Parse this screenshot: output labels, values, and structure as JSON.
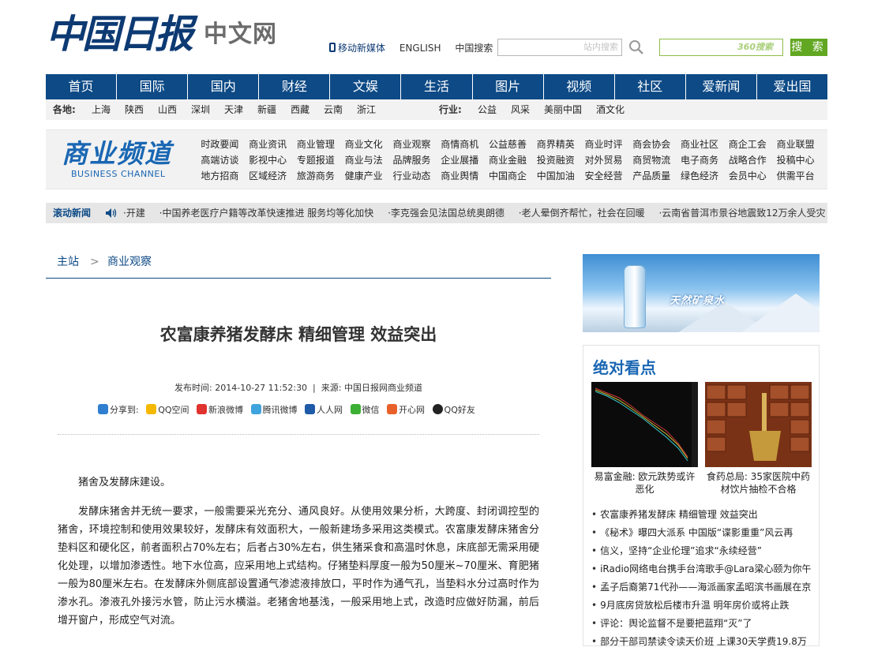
{
  "header": {
    "logo_main": "中国日报",
    "logo_sub": "中文网",
    "links": [
      "移动新媒体",
      "ENGLISH",
      "中国搜索"
    ],
    "site_search_placeholder": "站内搜索",
    "search_360_placeholder": "360搜索",
    "search_360_button": "搜 索"
  },
  "nav": [
    "首页",
    "国际",
    "国内",
    "财经",
    "文娱",
    "生活",
    "图片",
    "视频",
    "社区",
    "爱新闻",
    "爱出国"
  ],
  "subnav": {
    "region_label": "各地:",
    "regions": [
      "上海",
      "陕西",
      "山西",
      "深圳",
      "天津",
      "新疆",
      "西藏",
      "云南",
      "浙江"
    ],
    "industry_label": "行业:",
    "industries": [
      "公益",
      "风采",
      "美丽中国",
      "酒文化"
    ]
  },
  "channel": {
    "logo_cn": "商业频道",
    "logo_en": "BUSINESS CHANNEL",
    "rows": [
      [
        "时政要闻",
        "商业资讯",
        "商业管理",
        "商业文化",
        "商业观察",
        "商情商机",
        "公益慈善",
        "商界精英",
        "商业时评",
        "商会协会",
        "商业社区",
        "商企工会",
        "商业联盟"
      ],
      [
        "高端访谈",
        "影视中心",
        "专题报道",
        "商业与法",
        "品牌服务",
        "企业展播",
        "商业金融",
        "投资融资",
        "对外贸易",
        "商贸物流",
        "电子商务",
        "战略合作",
        "投稿中心"
      ],
      [
        "地方招商",
        "区域经济",
        "旅游商务",
        "健康产业",
        "行业动态",
        "商业舆情",
        "中国商企",
        "中国加油",
        "安全经营",
        "产品质量",
        "绿色经济",
        "会员中心",
        "供需平台"
      ]
    ]
  },
  "ticker": {
    "label": "滚动新闻",
    "items": [
      "·开建",
      "·中国养老医疗户籍等改革快速推进 服务均等化加快",
      "·李克强会见法国总统奥朗德",
      "·老人晕倒齐帮忙，社会在回暖",
      "·云南省普洱市景谷地震致12万余人受灾"
    ]
  },
  "breadcrumb": {
    "home": "主站",
    "sep": ">",
    "section": "商业观察"
  },
  "article": {
    "title": "农富康养猪发酵床 精细管理 效益突出",
    "meta": "发布时间: 2014-10-27 11:52:30  |  来源: 中国日报网商业频道",
    "share_label": "分享到:",
    "share_targets": [
      "QQ空间",
      "新浪微博",
      "腾讯微博",
      "人人网",
      "微信",
      "开心网",
      "QQ好友"
    ],
    "paragraphs": [
      "猪舍及发酵床建设。",
      "发酵床猪舍并无统一要求，一般需要采光充分、通风良好。从使用效果分析，大跨度、封闭调控型的猪舍，环境控制和使用效果较好，发酵床有效面积大，一般新建场多采用这类模式。农富康发酵床猪舍分垫料区和硬化区，前者面积占70%左右；后者占30%左右，供生猪采食和高温时休息，床底部无需采用硬化处理，以增加渗透性。地下水位高，应采用地上式结构。仔猪垫料厚度一般为50厘米~70厘米、育肥猪一般为80厘米左右。在发酵床外侧底部设置通气渗滤液排放口，平时作为通气孔，当垫料水分过高时作为渗水孔。渗液孔外接污水管，防止污水横溢。老猪舍地基浅，一般采用地上式，改造时应做好防漏，前后增开窗户，形成空气对流。"
    ]
  },
  "sidebar": {
    "ad_text": "天然矿泉水",
    "box_title": "绝对看点",
    "pics": [
      {
        "caption": "易富金融: 欧元跌势或许恶化"
      },
      {
        "caption": "食药总局: 35家医院中药材饮片抽检不合格"
      }
    ],
    "list": [
      "农富康养猪发酵床 精细管理 效益突出",
      "《秘术》曝四大派系 中国版“谍影重重”风云再",
      "信义，坚持“企业伦理”追求“永续经营”",
      "iRadio网络电台携手台湾歌手@Lara梁心颐为你午",
      "孟子后裔第71代孙——海派画家孟昭滨书画展在京",
      "9月底房贷放松后楼市升温 明年房价或将止跌",
      "评论：舆论监督不是要把蓝翔“灭”了",
      "部分干部司禁读令读天价班 上课30天学费19.8万"
    ]
  },
  "colors": {
    "brand_blue": "#0d4a86",
    "channel_blue": "#1a67b3",
    "search_green": "#62a722"
  }
}
